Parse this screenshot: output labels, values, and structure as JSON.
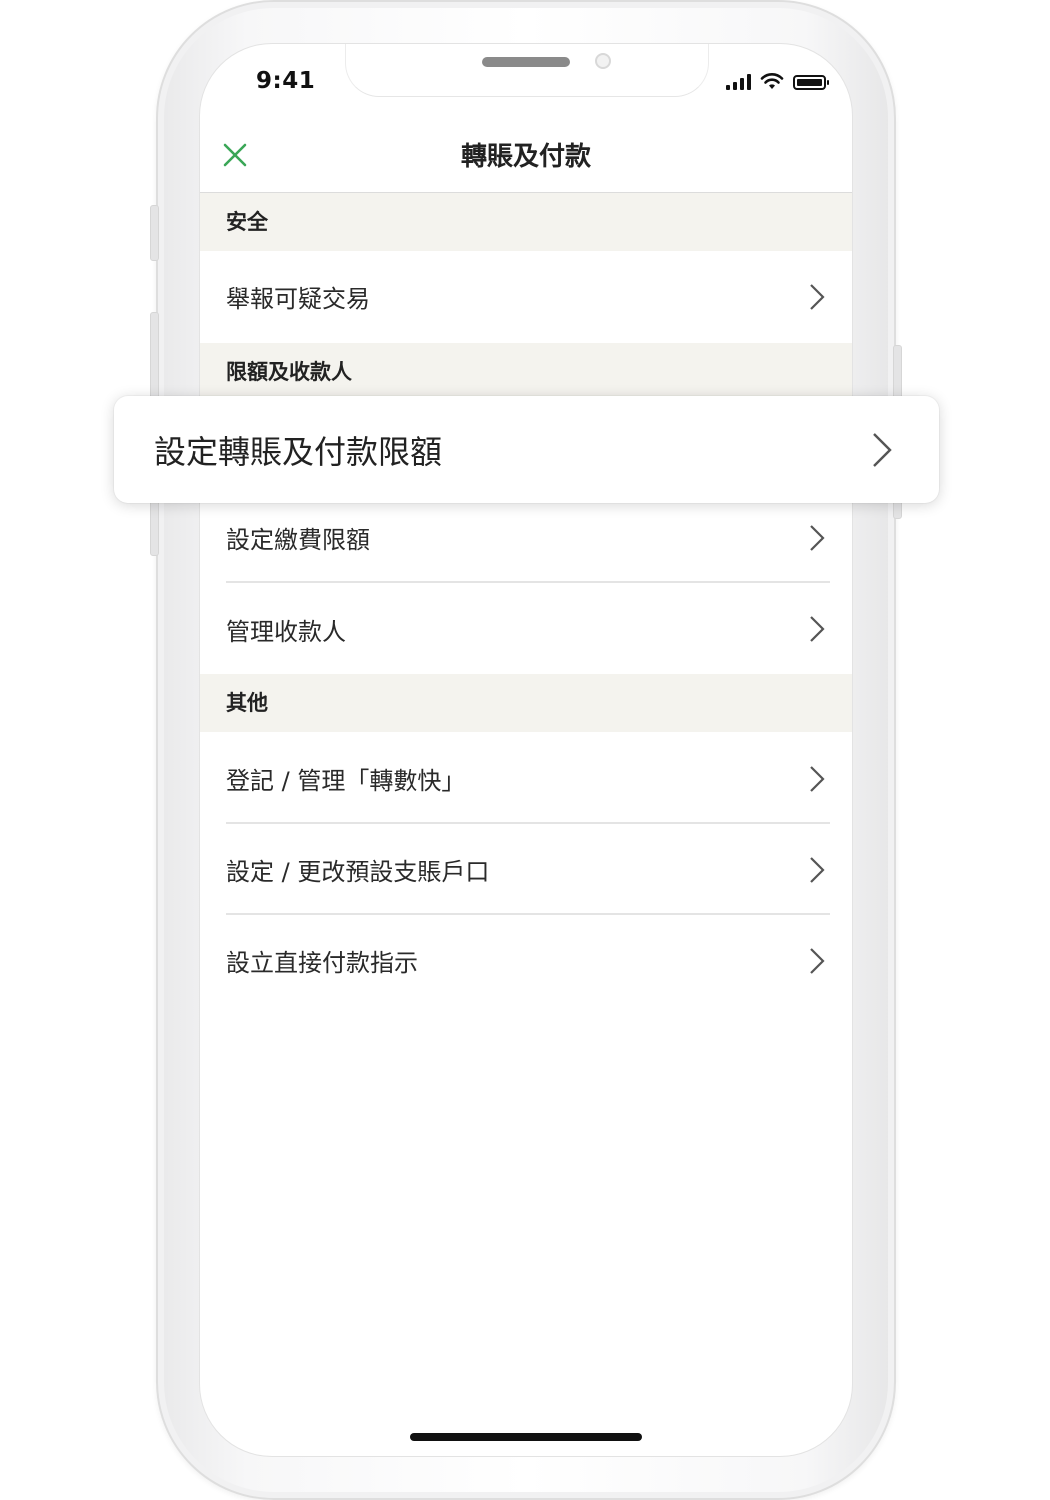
{
  "status_bar": {
    "time": "9:41"
  },
  "navbar": {
    "title": "轉賬及付款",
    "close_icon": "close-icon",
    "accent_color": "#3aa657"
  },
  "sections": {
    "security": {
      "header": "安全",
      "items": [
        "舉報可疑交易"
      ]
    },
    "limits": {
      "header": "限額及收款人",
      "items": [
        "設定轉賬及付款限額",
        "設定繳費限額",
        "管理收款人"
      ]
    },
    "others": {
      "header": "其他",
      "items": [
        "登記 / 管理「轉數快」",
        "設定 / 更改預設支賬戶口",
        "設立直接付款指示"
      ]
    }
  },
  "colors": {
    "section_bg": "#f4f3ee",
    "text": "#222222",
    "chevron": "#555555"
  }
}
